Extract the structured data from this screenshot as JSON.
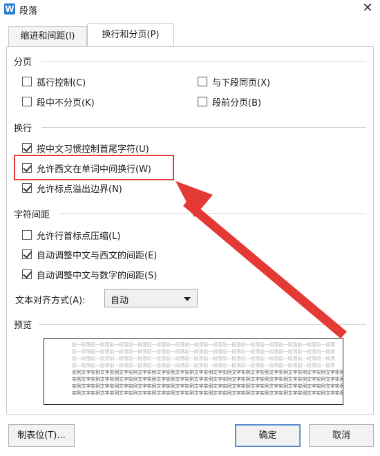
{
  "window": {
    "title": "段落",
    "app_icon_letter": "W"
  },
  "tabs": [
    {
      "label": "缩进和间距(I)",
      "active": false
    },
    {
      "label": "换行和分页(P)",
      "active": true
    }
  ],
  "pagination": {
    "title": "分页",
    "items": [
      {
        "label": "孤行控制(C)",
        "checked": false
      },
      {
        "label": "与下段同页(X)",
        "checked": false
      },
      {
        "label": "段中不分页(K)",
        "checked": false
      },
      {
        "label": "段前分页(B)",
        "checked": false
      }
    ]
  },
  "line_break": {
    "title": "换行",
    "items": [
      {
        "label": "按中文习惯控制首尾字符(U)",
        "checked": true
      },
      {
        "label": "允许西文在单词中间换行(W)",
        "checked": true
      },
      {
        "label": "允许标点溢出边界(N)",
        "checked": true
      }
    ]
  },
  "char_spacing": {
    "title": "字符间距",
    "items": [
      {
        "label": "允许行首标点压缩(L)",
        "checked": false
      },
      {
        "label": "自动调整中文与西文的间距(E)",
        "checked": true
      },
      {
        "label": "自动调整中文与数字的间距(S)",
        "checked": true
      }
    ],
    "align_label": "文本对齐方式(A):",
    "align_value": "自动"
  },
  "preview": {
    "title": "预览",
    "light_text": "前一段落前一段落前一段落前一段落前一段落前一段落前一段落前一段落前一段落前一段落前一段落前一段落前一段落前一段落",
    "dark_text": "实例文字实例文字实例文字实例文字实例文字实例文字实例文字实例文字实例文字实例文字实例文字实例文字实例文字实例文字实例文字实例"
  },
  "buttons": {
    "tabstops": "制表位(T)...",
    "ok": "确定",
    "cancel": "取消"
  },
  "colors": {
    "annotation_red": "#e53935",
    "ok_border": "#4a82c6"
  }
}
